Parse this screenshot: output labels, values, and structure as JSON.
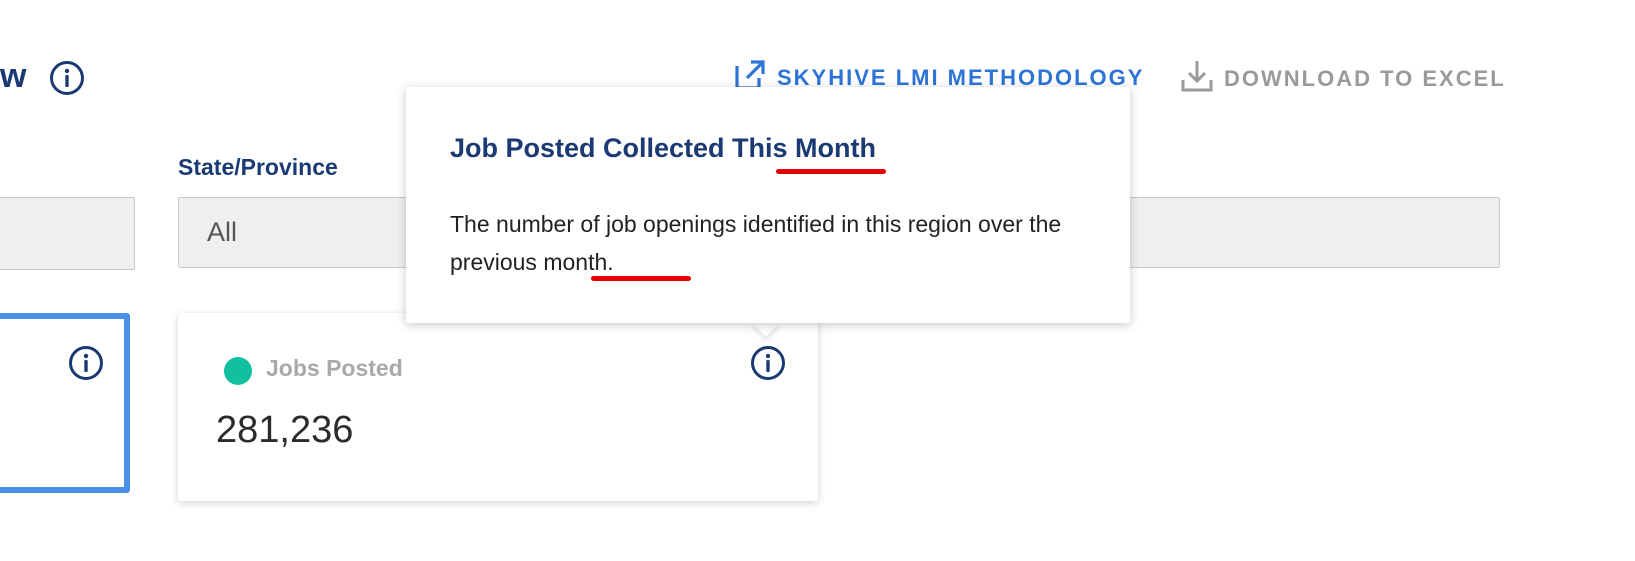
{
  "header": {
    "title_fragment": "w",
    "links": {
      "methodology": "SKYHIVE LMI METHODOLOGY",
      "download": "DOWNLOAD TO EXCEL"
    }
  },
  "filters": {
    "state_label": "State/Province",
    "state_value": "All"
  },
  "cards": {
    "jobs_posted": {
      "label": "Jobs Posted",
      "value": "281,236",
      "dot_color": "#11c09e"
    }
  },
  "tooltip": {
    "title": "Job Posted Collected This Month",
    "body": "The number of job openings identified in this region over the previous month."
  },
  "colors": {
    "brand_navy": "#1b3a73",
    "link_blue": "#2d74d6",
    "selected_border": "#4a90e8",
    "annotation_red": "#e60000"
  },
  "icons": {
    "info": "info-circle-icon",
    "external_link": "external-link-icon",
    "download": "download-icon"
  }
}
